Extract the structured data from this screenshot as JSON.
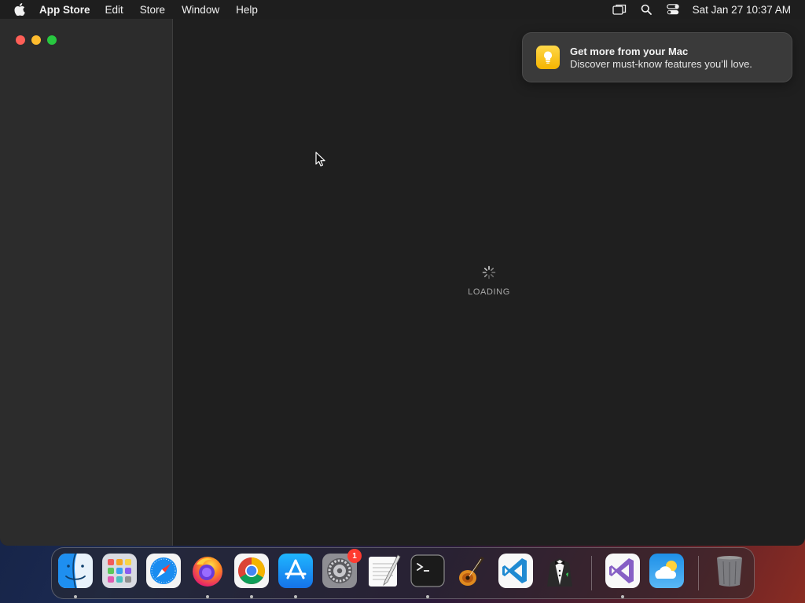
{
  "menubar": {
    "apple_icon": "apple-logo-icon",
    "app_name": "App Store",
    "items": [
      "Edit",
      "Store",
      "Window",
      "Help"
    ],
    "status_icons": [
      "screen-mirroring-icon",
      "search-icon",
      "control-center-icon"
    ],
    "clock": "Sat Jan 27  10:37 AM"
  },
  "window": {
    "traffic_lights": {
      "close": "#ff5f57",
      "minimize": "#febc2e",
      "maximize": "#28c840"
    },
    "loading_label": "LOADING"
  },
  "notification": {
    "icon": "lightbulb-icon",
    "title": "Get more from your Mac",
    "body": "Discover must-know features you’ll love."
  },
  "dock": {
    "items": [
      {
        "name": "Finder",
        "icon": "finder-icon",
        "running": true
      },
      {
        "name": "Launchpad",
        "icon": "launchpad-icon",
        "running": false
      },
      {
        "name": "Safari",
        "icon": "safari-icon",
        "running": false
      },
      {
        "name": "Firefox",
        "icon": "firefox-icon",
        "running": true
      },
      {
        "name": "Chrome",
        "icon": "chrome-icon",
        "running": true
      },
      {
        "name": "App Store",
        "icon": "app-store-icon",
        "running": true
      },
      {
        "name": "System Settings",
        "icon": "system-settings-icon",
        "running": false,
        "badge": "1"
      },
      {
        "name": "TextEdit",
        "icon": "textedit-icon",
        "running": false
      },
      {
        "name": "Terminal",
        "icon": "terminal-icon",
        "running": true
      },
      {
        "name": "GarageBand",
        "icon": "garageband-icon",
        "running": false
      },
      {
        "name": "Visual Studio Code",
        "icon": "vscode-icon",
        "running": false
      },
      {
        "name": "Bartender",
        "icon": "bartender-icon",
        "running": false
      },
      {
        "name": "Visual Studio",
        "icon": "visual-studio-icon",
        "running": true
      },
      {
        "name": "Weather",
        "icon": "weather-icon",
        "running": false
      },
      {
        "name": "Trash",
        "icon": "trash-icon",
        "running": false
      }
    ]
  }
}
